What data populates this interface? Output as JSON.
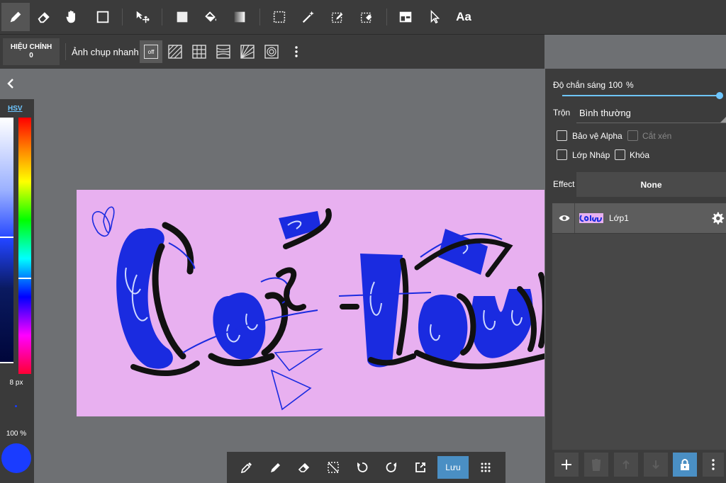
{
  "toolbar": {
    "tools": [
      "pencil-icon",
      "eraser-icon",
      "hand-icon",
      "rectangle-icon",
      "move-icon",
      "fill-color-icon",
      "bucket-icon",
      "gradient-icon",
      "selection-icon",
      "magic-wand-icon",
      "select-pen-icon",
      "select-eraser-icon",
      "layout-icon",
      "pointer-icon",
      "text-icon"
    ],
    "text_tool_label": "Aa"
  },
  "subbar": {
    "adjust_label": "HIỆU CHỈNH",
    "adjust_value": "0",
    "snapshot_label": "Ảnh chụp nhanh",
    "snap_off_label": "off"
  },
  "left_panel": {
    "mode_label": "HSV",
    "brush_size": "8 px",
    "opacity": "100 %",
    "color": "#1a3cff"
  },
  "right_panel": {
    "opacity_label": "Độ chắn sáng",
    "opacity_value": "100",
    "opacity_unit": "%",
    "blend_label": "Trộn",
    "blend_value": "Bình thường",
    "protect_alpha_label": "Bảo vệ Alpha",
    "clip_label": "Cắt xén",
    "draft_layer_label": "Lớp Nháp",
    "lock_label": "Khóa",
    "effect_label": "Effect",
    "effect_value": "None",
    "layer_name": "Lớp1",
    "accent": "#6ec6ff"
  },
  "bottom_bar": {
    "save_label": "Lưu"
  },
  "canvas": {
    "background": "#e8b0f0",
    "ink_color": "#1a2be0"
  }
}
